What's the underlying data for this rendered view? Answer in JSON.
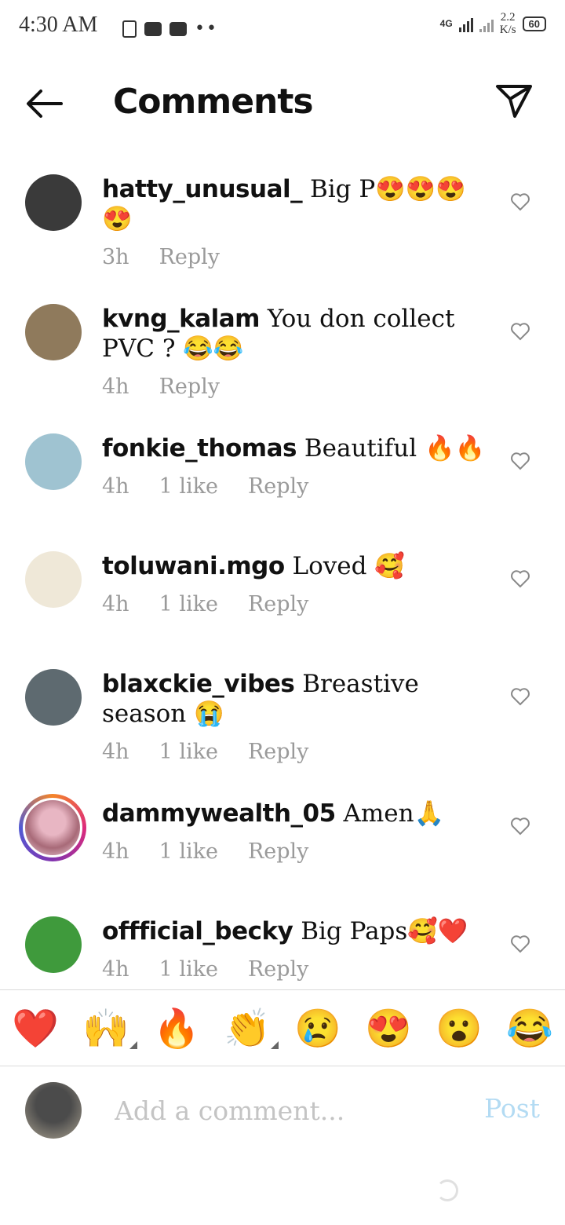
{
  "status_bar": {
    "time": "4:30 AM",
    "network": "4G",
    "speed_value": "2.2",
    "speed_unit": "K/s",
    "battery": "60"
  },
  "header": {
    "title": "Comments"
  },
  "comments": [
    {
      "user": "hatty_unusual_",
      "text": " Big P😍😍😍😍",
      "time": "3h",
      "likes": "",
      "reply": "Reply",
      "avatar_color": "#3a3a3a"
    },
    {
      "user": "kvng_kalam",
      "text": " You don collect PVC ? 😂😂",
      "time": "4h",
      "likes": "",
      "reply": "Reply",
      "avatar_color": "#8f7a5c"
    },
    {
      "user": "fonkie_thomas",
      "text": " Beautiful  🔥🔥",
      "time": "4h",
      "likes": "1 like",
      "reply": "Reply",
      "avatar_color": "#9fc3d1"
    },
    {
      "user": "toluwani.mgo",
      "text": " Loved 🥰",
      "time": "4h",
      "likes": "1 like",
      "reply": "Reply",
      "avatar_color": "#efe8d8"
    },
    {
      "user": "blaxckie_vibes",
      "text": " Breastive season 😭",
      "time": "4h",
      "likes": "1 like",
      "reply": "Reply",
      "avatar_color": "#5e6a70"
    },
    {
      "user": "dammywealth_05",
      "text": " Amen🙏",
      "time": "4h",
      "likes": "1 like",
      "reply": "Reply",
      "avatar_color": "#c98a9a"
    },
    {
      "user": "offficial_becky",
      "text": " Big Paps🥰❤️",
      "time": "4h",
      "likes": "1 like",
      "reply": "Reply",
      "avatar_color": "#3f9a3c"
    }
  ],
  "reactions": [
    "❤️",
    "🙌",
    "🔥",
    "👏",
    "😢",
    "😍",
    "😮",
    "😂"
  ],
  "composer": {
    "placeholder": "Add a comment...",
    "post_label": "Post"
  }
}
